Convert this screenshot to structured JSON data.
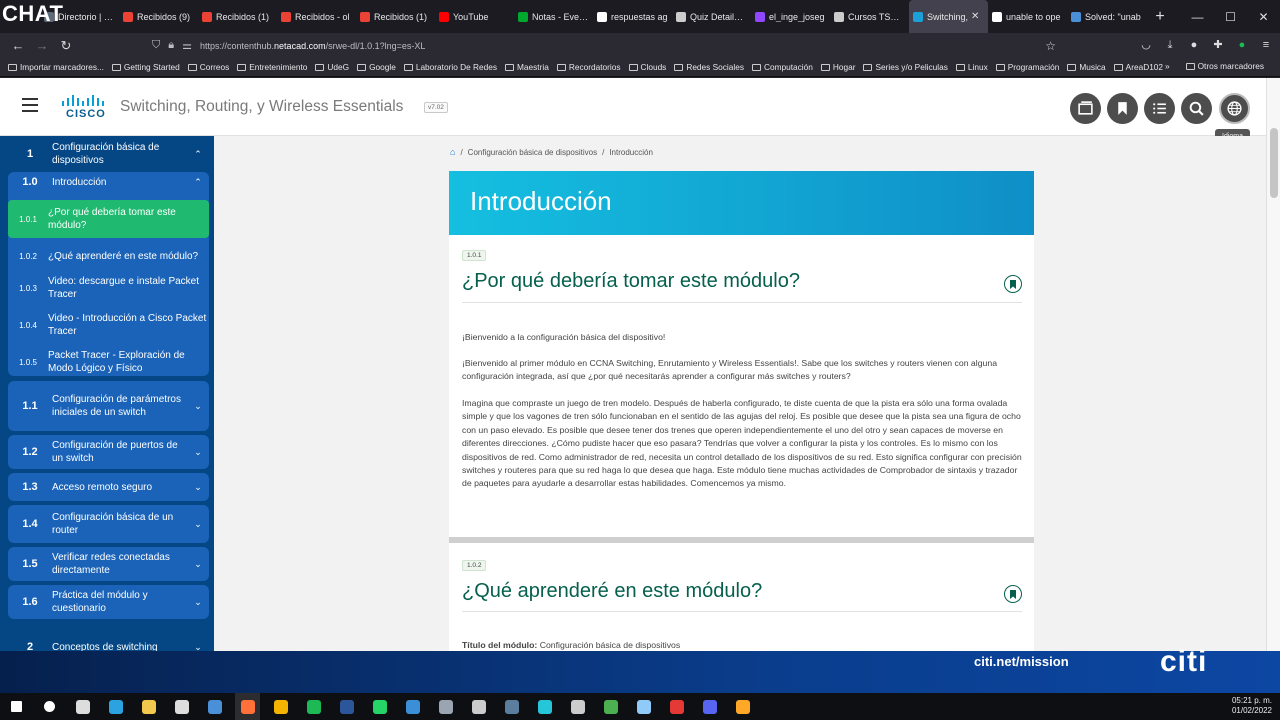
{
  "overlay": {
    "title": "CHAT"
  },
  "browser": {
    "tabs": [
      {
        "label": "Directorio | Ce",
        "color": "#5e6b7a"
      },
      {
        "label": "Recibidos (9)",
        "color": "#ea4335"
      },
      {
        "label": "Recibidos (1)",
        "color": "#ea4335"
      },
      {
        "label": "Recibidos - ol",
        "color": "#ea4335"
      },
      {
        "label": "Recibidos (1)",
        "color": "#ea4335"
      },
      {
        "label": "YouTube",
        "color": "#ff0000"
      },
      {
        "label": "Notas - Everno",
        "color": "#00a82d"
      },
      {
        "label": "respuestas ag",
        "color": "#ffffff"
      },
      {
        "label": "Quiz Details Page",
        "color": "#cccccc"
      },
      {
        "label": "el_inge_joseg",
        "color": "#9146ff"
      },
      {
        "label": "Cursos TSC | (I",
        "color": "#cccccc"
      },
      {
        "label": "Switching,",
        "color": "#1ba0d7",
        "active": true
      },
      {
        "label": "unable to ope",
        "color": "#ffffff"
      },
      {
        "label": "Solved: \"unab",
        "color": "#4a90d9"
      }
    ],
    "new_tab": "+",
    "window_controls": [
      "—",
      "☐",
      "✕"
    ],
    "url": {
      "prefix": "https://contenthub.",
      "domain": "netacad.com",
      "path": "/srwe-dl/1.0.1?lng=es-XL"
    },
    "bookmarks": [
      "Importar marcadores...",
      "Getting Started",
      "Correos",
      "Entretenimiento",
      "UdeG",
      "Google",
      "Laboratorio De Redes",
      "Maestria",
      "Recordatorios",
      "Clouds",
      "Redes Sociales",
      "Computación",
      "Hogar",
      "Series y/o Peliculas",
      "Linux",
      "Programación",
      "Musica",
      "AreaD102"
    ],
    "other_bookmarks": "Otros marcadores",
    "more_bookmarks": "»"
  },
  "header": {
    "brand": "CISCO",
    "course_title": "Switching, Routing, y Wireless Essentials",
    "version": "v7.02",
    "tooltip": "Idioma"
  },
  "sidebar": {
    "module1": {
      "num": "1",
      "label": "Configuración básica de dispositivos",
      "chevron": "⌃"
    },
    "section10": {
      "num": "1.0",
      "label": "Introducción",
      "chevron": "⌃"
    },
    "topics": [
      {
        "num": "1.0.1",
        "label": "¿Por qué debería tomar este módulo?"
      },
      {
        "num": "1.0.2",
        "label": "¿Qué aprenderé en este módulo?"
      },
      {
        "num": "1.0.3",
        "label": "Video: descargue e instale Packet Tracer"
      },
      {
        "num": "1.0.4",
        "label": "Video - Introducción a Cisco Packet Tracer"
      },
      {
        "num": "1.0.5",
        "label": "Packet Tracer - Exploración de Modo Lógico y Físico"
      }
    ],
    "sections": [
      {
        "num": "1.1",
        "label": "Configuración de parámetros iniciales de un switch",
        "chevron": "⌄"
      },
      {
        "num": "1.2",
        "label": "Configuración de puertos de un switch",
        "chevron": "⌄"
      },
      {
        "num": "1.3",
        "label": "Acceso remoto seguro",
        "chevron": "⌄"
      },
      {
        "num": "1.4",
        "label": "Configuración básica de un router",
        "chevron": "⌄"
      },
      {
        "num": "1.5",
        "label": "Verificar redes conectadas directamente",
        "chevron": "⌄"
      },
      {
        "num": "1.6",
        "label": "Práctica del módulo y cuestionario",
        "chevron": "⌄"
      }
    ],
    "module2": {
      "num": "2",
      "label": "Conceptos de switching",
      "chevron": "⌄"
    }
  },
  "content": {
    "breadcrumb": [
      "Configuración básica de dispositivos",
      "Introducción"
    ],
    "breadcrumb_sep": "/",
    "banner_title": "Introducción",
    "section1": {
      "chip": "1.0.1",
      "title": "¿Por qué debería tomar este módulo?",
      "paragraphs": [
        "¡Bienvenido a la configuración básica del dispositivo!",
        "¡Bienvenido al primer módulo en CCNA Switching, Enrutamiento y Wireless Essentials!. Sabe que los switches y routers vienen con alguna configuración integrada, así que ¿por qué necesitarás aprender a configurar más switches y routers?",
        "Imagina que compraste un juego de tren modelo. Después de haberla configurado, te diste cuenta de que la pista era sólo una forma ovalada simple y que los vagones de tren sólo funcionaban en el sentido de las agujas del reloj. Es posible que desee que la pista sea una figura de ocho con un paso elevado. Es posible que desee tener dos trenes que operen independientemente el uno del otro y sean capaces de moverse en diferentes direcciones. ¿Cómo pudiste hacer que eso pasara? Tendrías que volver a configurar la pista y los controles. Es lo mismo con los dispositivos de red. Como administrador de red, necesita un control detallado de los dispositivos de su red. Esto significa configurar con precisión switches y routeres para que su red haga lo que desea que haga. Este módulo tiene muchas actividades de Comprobador de sintaxis y trazador de paquetes para ayudarle a desarrollar estas habilidades. Comencemos ya mismo."
      ]
    },
    "section2": {
      "chip": "1.0.2",
      "title": "¿Qué aprenderé en este módulo?",
      "module_title_label": "Título del módulo:",
      "module_title_value": "Configuración básica de dispositivos"
    }
  },
  "ad": {
    "text": "citi.net/mission",
    "logo": "citi"
  },
  "taskbar": {
    "time": "05:21 p. m.",
    "date": "01/02/2022",
    "icons": [
      {
        "name": "start-icon",
        "color": "#ffffff"
      },
      {
        "name": "search-icon",
        "color": "#ffffff"
      },
      {
        "name": "task-view-icon",
        "color": "#dddddd"
      },
      {
        "name": "edge-icon",
        "color": "#2aa3e0"
      },
      {
        "name": "file-explorer-icon",
        "color": "#f2c94c"
      },
      {
        "name": "store-icon",
        "color": "#dddddd"
      },
      {
        "name": "mail-icon",
        "color": "#4a90d9"
      },
      {
        "name": "firefox-icon",
        "color": "#ff7139"
      },
      {
        "name": "chrome-icon",
        "color": "#f4b400"
      },
      {
        "name": "spotify-icon",
        "color": "#1db954"
      },
      {
        "name": "word-icon",
        "color": "#2b579a"
      },
      {
        "name": "whatsapp-icon",
        "color": "#25d366"
      },
      {
        "name": "thunderbird-icon",
        "color": "#3a8fd6"
      },
      {
        "name": "calculator-icon",
        "color": "#9aa5b1"
      },
      {
        "name": "vpn-icon",
        "color": "#cccccc"
      },
      {
        "name": "steam-icon",
        "color": "#5c7e9e"
      },
      {
        "name": "download-icon",
        "color": "#26c6da"
      },
      {
        "name": "obs-icon",
        "color": "#cccccc"
      },
      {
        "name": "photos-icon",
        "color": "#4caf50"
      },
      {
        "name": "notepad-icon",
        "color": "#90caf9"
      },
      {
        "name": "acrobat-icon",
        "color": "#e53935"
      },
      {
        "name": "discord-icon",
        "color": "#5865f2"
      },
      {
        "name": "packet-tracer-icon",
        "color": "#ffa726"
      }
    ]
  },
  "colors": {
    "sidebar_bg": "#054785",
    "section_card": "#1a63b8",
    "active_topic": "#1fba70",
    "accent_green": "#06604d",
    "banner_start": "#15bfe0",
    "banner_end": "#0f8fc7"
  }
}
